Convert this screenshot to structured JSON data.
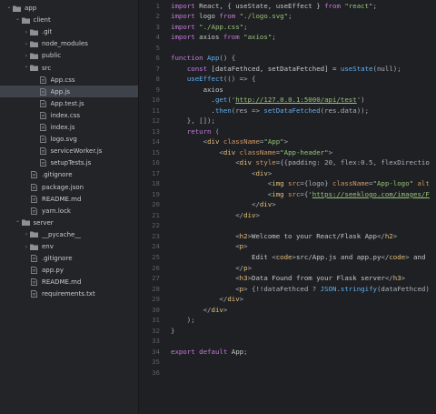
{
  "sidebar": {
    "items": [
      {
        "label": "app",
        "depth": 0,
        "kind": "folder",
        "open": true
      },
      {
        "label": "client",
        "depth": 1,
        "kind": "folder",
        "open": true
      },
      {
        "label": ".git",
        "depth": 2,
        "kind": "folder",
        "open": false
      },
      {
        "label": "node_modules",
        "depth": 2,
        "kind": "folder",
        "open": false
      },
      {
        "label": "public",
        "depth": 2,
        "kind": "folder",
        "open": false
      },
      {
        "label": "src",
        "depth": 2,
        "kind": "folder",
        "open": true
      },
      {
        "label": "App.css",
        "depth": 3,
        "kind": "file"
      },
      {
        "label": "App.js",
        "depth": 3,
        "kind": "file",
        "selected": true
      },
      {
        "label": "App.test.js",
        "depth": 3,
        "kind": "file"
      },
      {
        "label": "index.css",
        "depth": 3,
        "kind": "file"
      },
      {
        "label": "index.js",
        "depth": 3,
        "kind": "file"
      },
      {
        "label": "logo.svg",
        "depth": 3,
        "kind": "file"
      },
      {
        "label": "serviceWorker.js",
        "depth": 3,
        "kind": "file"
      },
      {
        "label": "setupTests.js",
        "depth": 3,
        "kind": "file"
      },
      {
        "label": ".gitignore",
        "depth": 2,
        "kind": "file"
      },
      {
        "label": "package.json",
        "depth": 2,
        "kind": "file"
      },
      {
        "label": "README.md",
        "depth": 2,
        "kind": "file"
      },
      {
        "label": "yarn.lock",
        "depth": 2,
        "kind": "file"
      },
      {
        "label": "server",
        "depth": 1,
        "kind": "folder",
        "open": true
      },
      {
        "label": "__pycache__",
        "depth": 2,
        "kind": "folder",
        "open": false
      },
      {
        "label": "env",
        "depth": 2,
        "kind": "folder",
        "open": false
      },
      {
        "label": ".gitignore",
        "depth": 2,
        "kind": "file"
      },
      {
        "label": "app.py",
        "depth": 2,
        "kind": "file"
      },
      {
        "label": "README.md",
        "depth": 2,
        "kind": "file"
      },
      {
        "label": "requirements.txt",
        "depth": 2,
        "kind": "file"
      }
    ]
  },
  "editor": {
    "lines": [
      [
        [
          "kw",
          "import"
        ],
        [
          "txt",
          " React, { useState, useEffect } "
        ],
        [
          "kw",
          "from"
        ],
        [
          "str",
          " \"react\""
        ],
        [
          "pun",
          ";"
        ]
      ],
      [
        [
          "kw",
          "import"
        ],
        [
          "txt",
          " logo "
        ],
        [
          "kw",
          "from"
        ],
        [
          "str",
          " \"./logo.svg\""
        ],
        [
          "pun",
          ";"
        ]
      ],
      [
        [
          "kw",
          "import"
        ],
        [
          "str",
          " \"./App.css\""
        ],
        [
          "pun",
          ";"
        ]
      ],
      [
        [
          "kw",
          "import"
        ],
        [
          "txt",
          " axios "
        ],
        [
          "kw",
          "from"
        ],
        [
          "str",
          " \"axios\""
        ],
        [
          "pun",
          ";"
        ]
      ],
      [],
      [
        [
          "kw",
          "function"
        ],
        [
          "fn",
          " App"
        ],
        [
          "pun",
          "() {"
        ]
      ],
      [
        [
          "txt",
          "    "
        ],
        [
          "kw",
          "const"
        ],
        [
          "txt",
          " [dataFethced, setDataFetched] = "
        ],
        [
          "fn",
          "useState"
        ],
        [
          "pun",
          "(null);"
        ]
      ],
      [
        [
          "txt",
          "    "
        ],
        [
          "fn",
          "useEffect"
        ],
        [
          "pun",
          "(() => {"
        ]
      ],
      [
        [
          "txt",
          "        axios"
        ]
      ],
      [
        [
          "txt",
          "          ."
        ],
        [
          "fn",
          "get"
        ],
        [
          "pun",
          "("
        ],
        [
          "str",
          "'"
        ],
        [
          "url",
          "http://127.0.0.1:5000/api/test"
        ],
        [
          "str",
          "'"
        ],
        [
          "pun",
          ")"
        ]
      ],
      [
        [
          "txt",
          "          ."
        ],
        [
          "fn",
          "then"
        ],
        [
          "pun",
          "(res => "
        ],
        [
          "fn",
          "setDataFetched"
        ],
        [
          "pun",
          "(res.data));"
        ]
      ],
      [
        [
          "pun",
          "    }, []);"
        ]
      ],
      [
        [
          "txt",
          "    "
        ],
        [
          "kw",
          "return"
        ],
        [
          "pun",
          " ("
        ]
      ],
      [
        [
          "txt",
          "        "
        ],
        [
          "pun",
          "<"
        ],
        [
          "tag",
          "div"
        ],
        [
          "attr",
          " className"
        ],
        [
          "pun",
          "="
        ],
        [
          "str",
          "\"App\""
        ],
        [
          "pun",
          ">"
        ]
      ],
      [
        [
          "txt",
          "            "
        ],
        [
          "pun",
          "<"
        ],
        [
          "tag",
          "div"
        ],
        [
          "attr",
          " className"
        ],
        [
          "pun",
          "="
        ],
        [
          "str",
          "\"App-header\""
        ],
        [
          "pun",
          ">"
        ]
      ],
      [
        [
          "txt",
          "                "
        ],
        [
          "pun",
          "<"
        ],
        [
          "tag",
          "div"
        ],
        [
          "attr",
          " style"
        ],
        [
          "pun",
          "={{padding: 20, flex:0.5, flexDirectio"
        ]
      ],
      [
        [
          "txt",
          "                    "
        ],
        [
          "pun",
          "<"
        ],
        [
          "tag",
          "div"
        ],
        [
          "pun",
          ">"
        ]
      ],
      [
        [
          "txt",
          "                        "
        ],
        [
          "pun",
          "<"
        ],
        [
          "tag",
          "img"
        ],
        [
          "attr",
          " src"
        ],
        [
          "pun",
          "={logo} "
        ],
        [
          "attr",
          "className"
        ],
        [
          "pun",
          "="
        ],
        [
          "str",
          "\"App-logo\""
        ],
        [
          "attr",
          " alt"
        ]
      ],
      [
        [
          "txt",
          "                        "
        ],
        [
          "pun",
          "<"
        ],
        [
          "tag",
          "img"
        ],
        [
          "attr",
          " src"
        ],
        [
          "pun",
          "={'"
        ],
        [
          "url",
          "https://seeklogo.com/images/F"
        ]
      ],
      [
        [
          "txt",
          "                    "
        ],
        [
          "pun",
          "</"
        ],
        [
          "tag",
          "div"
        ],
        [
          "pun",
          ">"
        ]
      ],
      [
        [
          "txt",
          "                "
        ],
        [
          "pun",
          "</"
        ],
        [
          "tag",
          "div"
        ],
        [
          "pun",
          ">"
        ]
      ],
      [],
      [
        [
          "txt",
          "                "
        ],
        [
          "pun",
          "<"
        ],
        [
          "tag",
          "h2"
        ],
        [
          "pun",
          ">"
        ],
        [
          "txt",
          "Welcome to your React/Flask App"
        ],
        [
          "pun",
          "</"
        ],
        [
          "tag",
          "h2"
        ],
        [
          "pun",
          ">"
        ]
      ],
      [
        [
          "txt",
          "                "
        ],
        [
          "pun",
          "<"
        ],
        [
          "tag",
          "p"
        ],
        [
          "pun",
          ">"
        ]
      ],
      [
        [
          "txt",
          "                    Edit "
        ],
        [
          "pun",
          "<"
        ],
        [
          "tag",
          "code"
        ],
        [
          "pun",
          ">"
        ],
        [
          "txt",
          "src/App.js and app.py"
        ],
        [
          "pun",
          "</"
        ],
        [
          "tag",
          "code"
        ],
        [
          "pun",
          ">"
        ],
        [
          "txt",
          " and"
        ]
      ],
      [
        [
          "txt",
          "                "
        ],
        [
          "pun",
          "</"
        ],
        [
          "tag",
          "p"
        ],
        [
          "pun",
          ">"
        ]
      ],
      [
        [
          "txt",
          "                "
        ],
        [
          "pun",
          "<"
        ],
        [
          "tag",
          "h3"
        ],
        [
          "pun",
          ">"
        ],
        [
          "txt",
          "Data Found from your Flask server"
        ],
        [
          "pun",
          "</"
        ],
        [
          "tag",
          "h3"
        ],
        [
          "pun",
          ">"
        ]
      ],
      [
        [
          "txt",
          "                "
        ],
        [
          "pun",
          "<"
        ],
        [
          "tag",
          "p"
        ],
        [
          "pun",
          "> {!!dataFethced ? "
        ],
        [
          "fn",
          "JSON"
        ],
        [
          "pun",
          "."
        ],
        [
          "fn",
          "stringify"
        ],
        [
          "pun",
          "(dataFethced)"
        ]
      ],
      [
        [
          "txt",
          "            "
        ],
        [
          "pun",
          "</"
        ],
        [
          "tag",
          "div"
        ],
        [
          "pun",
          ">"
        ]
      ],
      [
        [
          "txt",
          "        "
        ],
        [
          "pun",
          "</"
        ],
        [
          "tag",
          "div"
        ],
        [
          "pun",
          ">"
        ]
      ],
      [
        [
          "pun",
          "    );"
        ]
      ],
      [
        [
          "pun",
          "}"
        ]
      ],
      [],
      [
        [
          "kw",
          "export"
        ],
        [
          "kw",
          " default"
        ],
        [
          "txt",
          " App"
        ],
        [
          "pun",
          ";"
        ]
      ],
      [],
      []
    ]
  },
  "colors": {
    "sidebar_bg": "#232427",
    "editor_bg": "#1f2023",
    "selected_row": "#3d424b",
    "folder_icon": "#8d9096",
    "file_icon": "#7f8389"
  }
}
